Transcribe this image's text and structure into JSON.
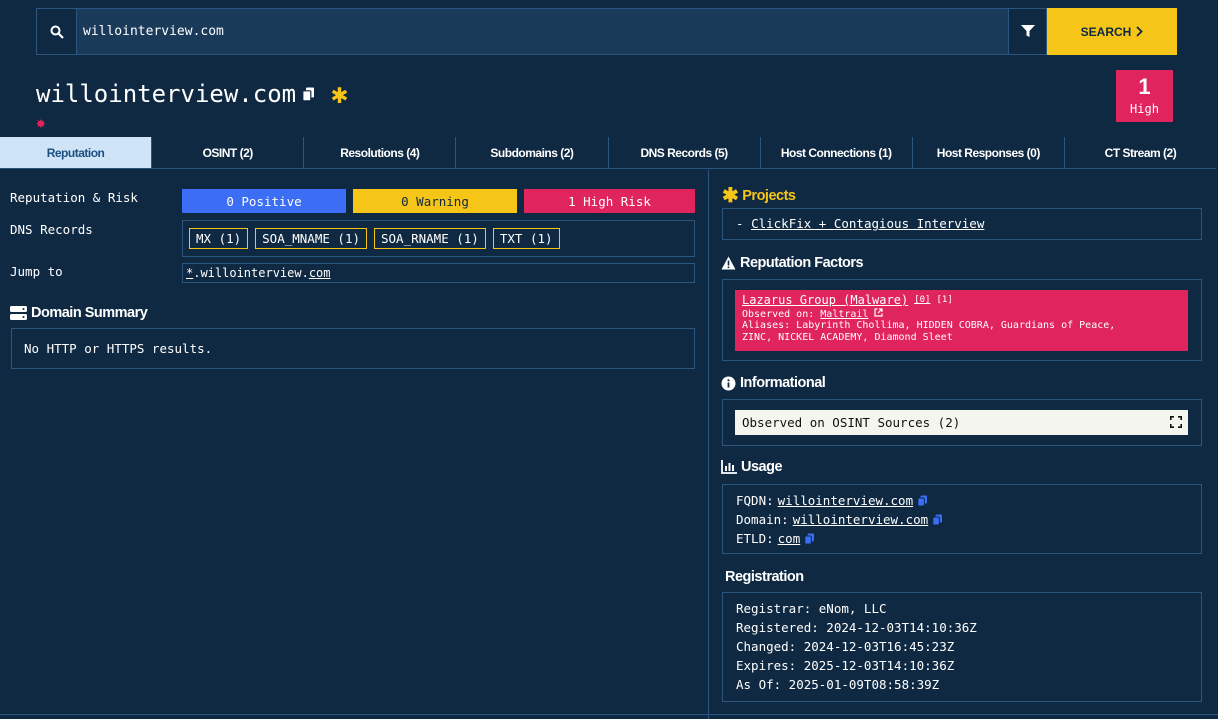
{
  "search": {
    "value": "willointerview.com",
    "button_label": "SEARCH"
  },
  "header": {
    "title": "willointerview.com"
  },
  "risk": {
    "count": "1",
    "level": "High"
  },
  "tabs": [
    {
      "label": "Reputation"
    },
    {
      "label": "OSINT (2)"
    },
    {
      "label": "Resolutions (4)"
    },
    {
      "label": "Subdomains (2)"
    },
    {
      "label": "DNS Records (5)"
    },
    {
      "label": "Host Connections (1)"
    },
    {
      "label": "Host Responses (0)"
    },
    {
      "label": "CT Stream (2)"
    }
  ],
  "reputation": {
    "label": "Reputation & Risk",
    "positive": "0 Positive",
    "warning": "0 Warning",
    "high_risk": "1 High Risk"
  },
  "dns": {
    "label": "DNS Records",
    "chips": [
      "MX (1)",
      "SOA_MNAME (1)",
      "SOA_RNAME (1)",
      "TXT (1)"
    ]
  },
  "jump": {
    "label": "Jump to",
    "wildcard": "*",
    "middle": ".willointerview.",
    "tld": "com"
  },
  "domain_summary": {
    "heading": "Domain Summary",
    "text": "No HTTP or HTTPS results."
  },
  "projects": {
    "heading": "Projects",
    "prefix": "- ",
    "item": "ClickFix + Contagious Interview"
  },
  "reputation_factors": {
    "heading": "Reputation Factors",
    "name": "Lazarus Group (Malware)",
    "ref0": "[0]",
    "ref1": "[1]",
    "observed_prefix": "Observed on: ",
    "observed_source": "Maltrail",
    "aliases_line1": "Aliases: Labyrinth Chollima, HIDDEN COBRA, Guardians of Peace,",
    "aliases_line2": "ZINC, NICKEL ACADEMY, Diamond Sleet"
  },
  "informational": {
    "heading": "Informational",
    "text": "Observed on OSINT Sources (2)"
  },
  "usage": {
    "heading": "Usage",
    "rows": [
      {
        "label": "FQDN: ",
        "value": "willointerview.com"
      },
      {
        "label": "Domain: ",
        "value": "willointerview.com"
      },
      {
        "label": "ETLD: ",
        "value": "com"
      }
    ]
  },
  "registration": {
    "heading": "Registration",
    "rows": [
      "Registrar: eNom, LLC",
      "Registered: 2024-12-03T14:10:36Z",
      "Changed: 2024-12-03T16:45:23Z",
      "Expires: 2025-12-03T14:10:36Z",
      "As Of: 2025-01-09T08:58:39Z"
    ]
  },
  "colors": {
    "background": "#0f2942",
    "accent_yellow": "#f5c518",
    "danger": "#e0245e",
    "positive": "#3b6ef5",
    "border": "#2a5680"
  }
}
